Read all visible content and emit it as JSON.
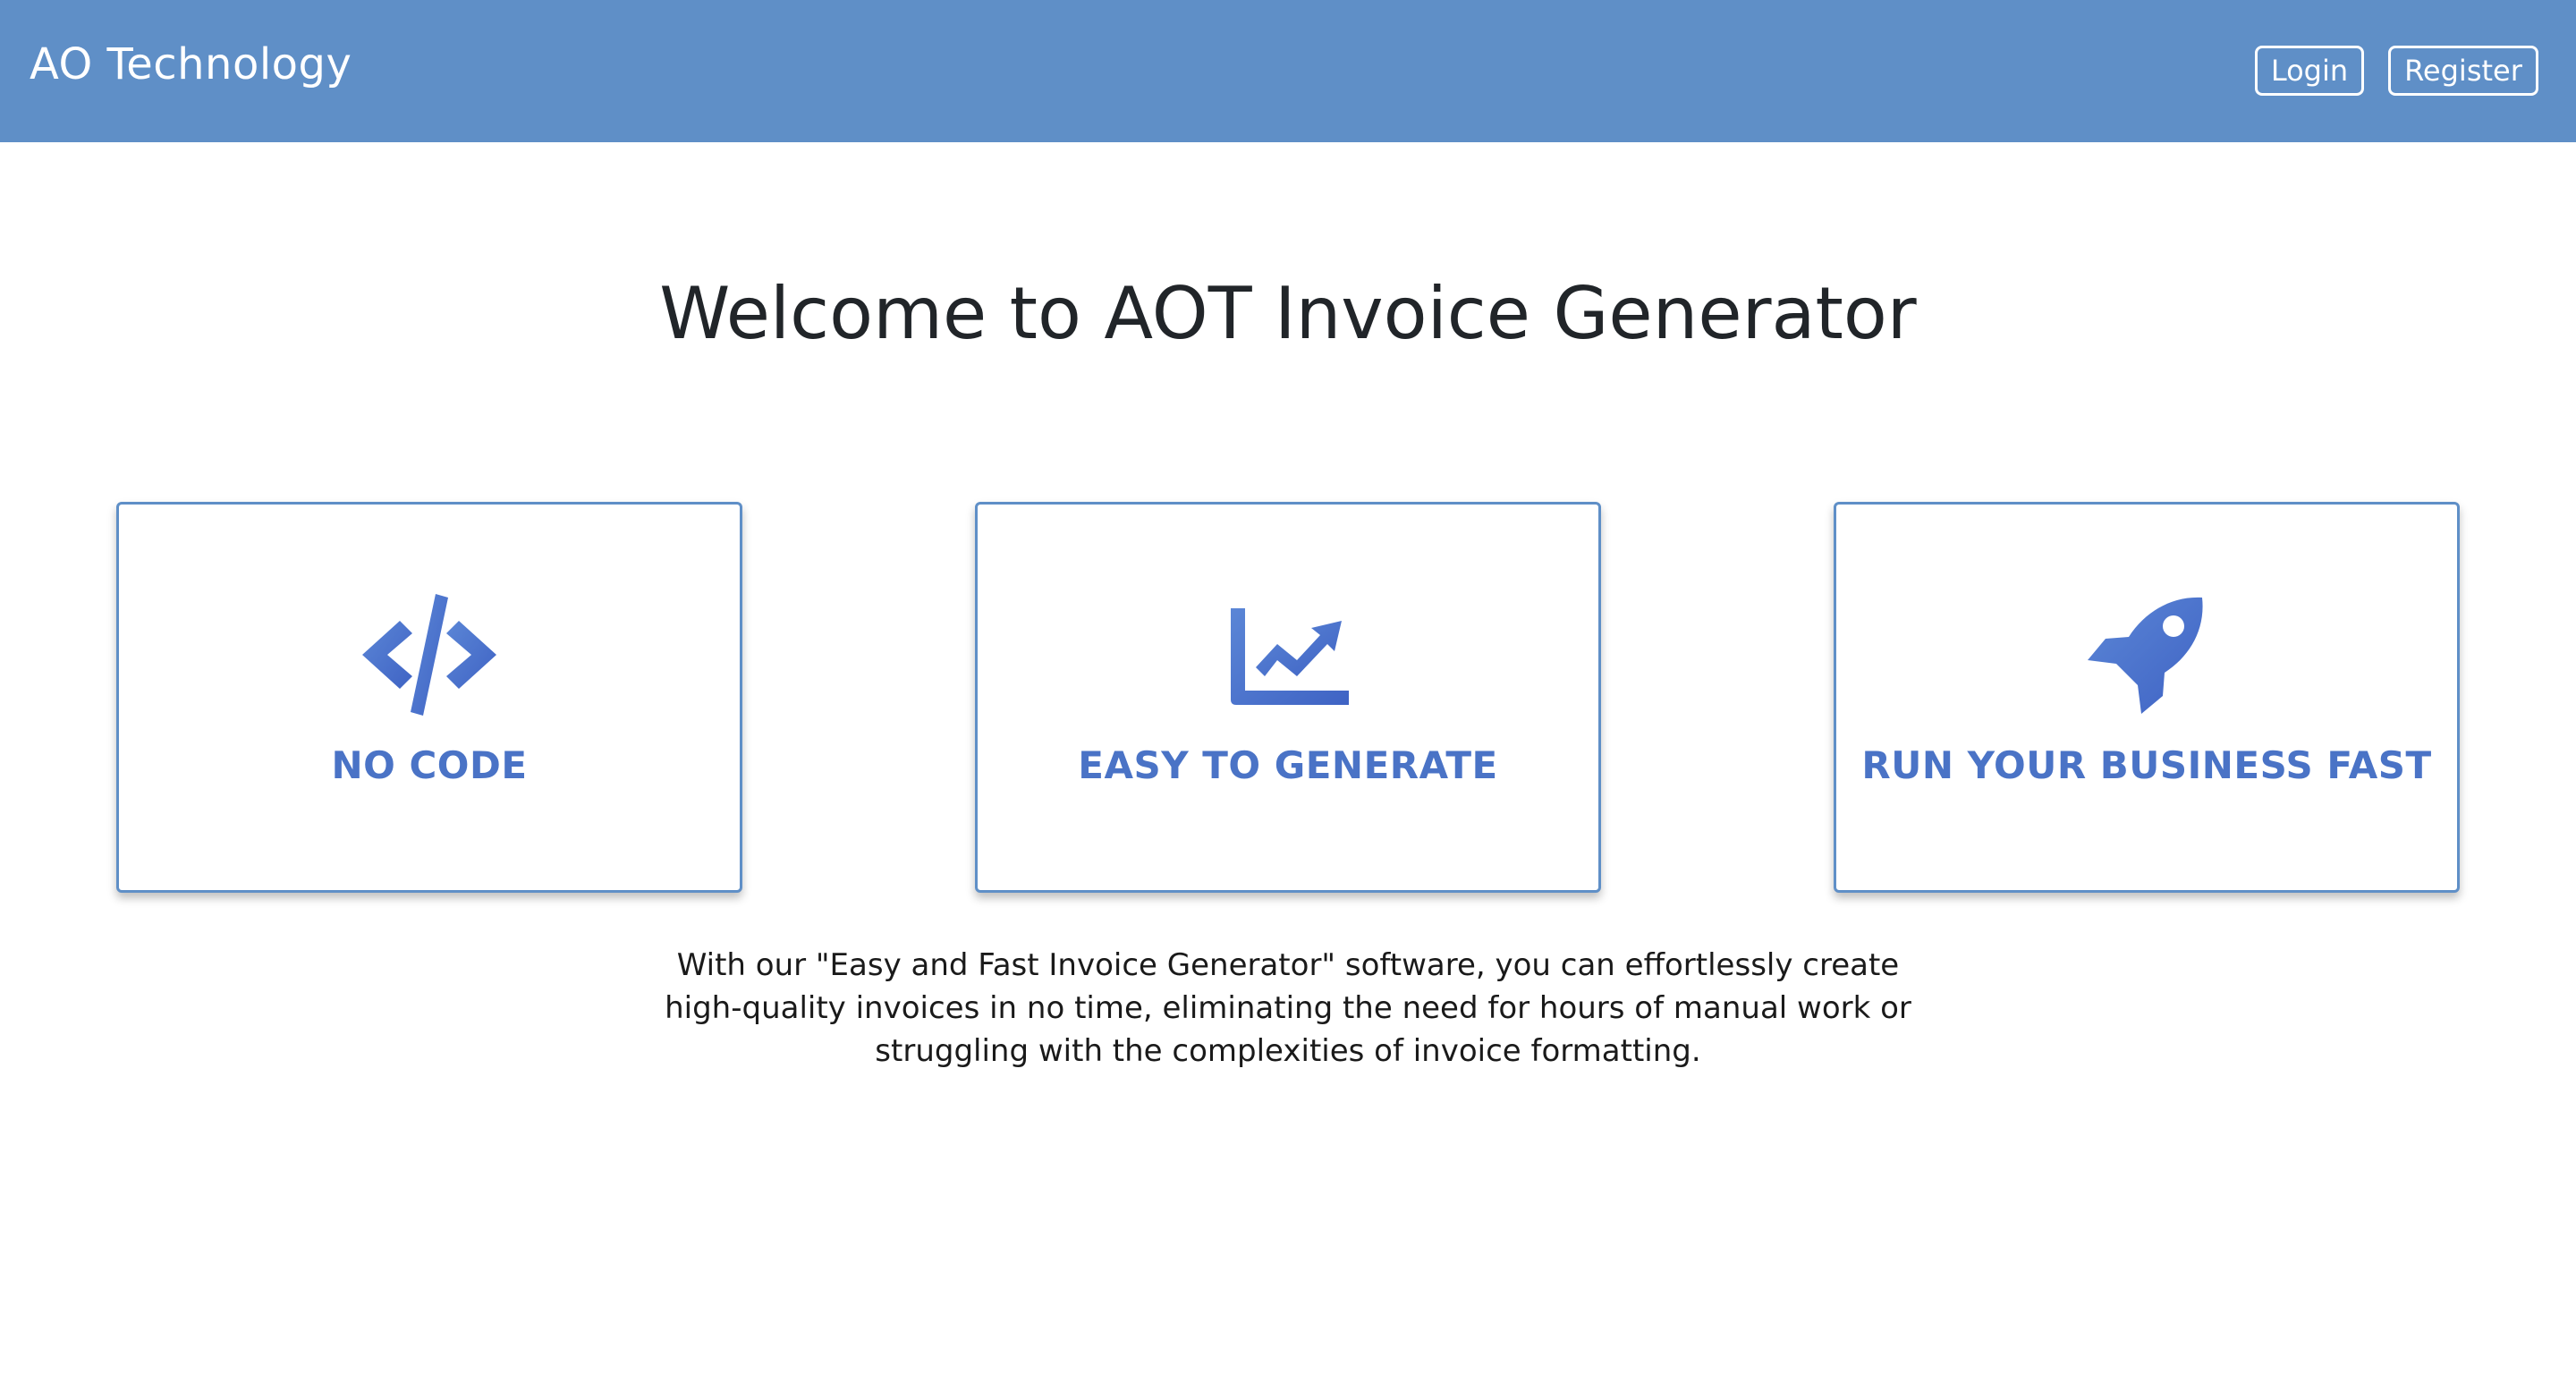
{
  "navbar": {
    "brand": "AO Technology",
    "login_label": "Login",
    "register_label": "Register",
    "background_color": "#5f8fc7"
  },
  "hero": {
    "title": "Welcome to AOT Invoice Generator"
  },
  "features": [
    {
      "label": "NO CODE",
      "icon": "code-icon"
    },
    {
      "label": "EASY TO GENERATE",
      "icon": "chart-line-icon"
    },
    {
      "label": "RUN YOUR BUSINESS FAST",
      "icon": "rocket-icon"
    }
  ],
  "description": "With our \"Easy and Fast Invoice Generator\" software, you can effortlessly create high-quality invoices in no time, eliminating the need for hours of manual work or struggling with the complexities of invoice formatting.",
  "colors": {
    "accent": "#4a73c6",
    "card_border": "#5f8fc7",
    "title_text": "#212529"
  }
}
